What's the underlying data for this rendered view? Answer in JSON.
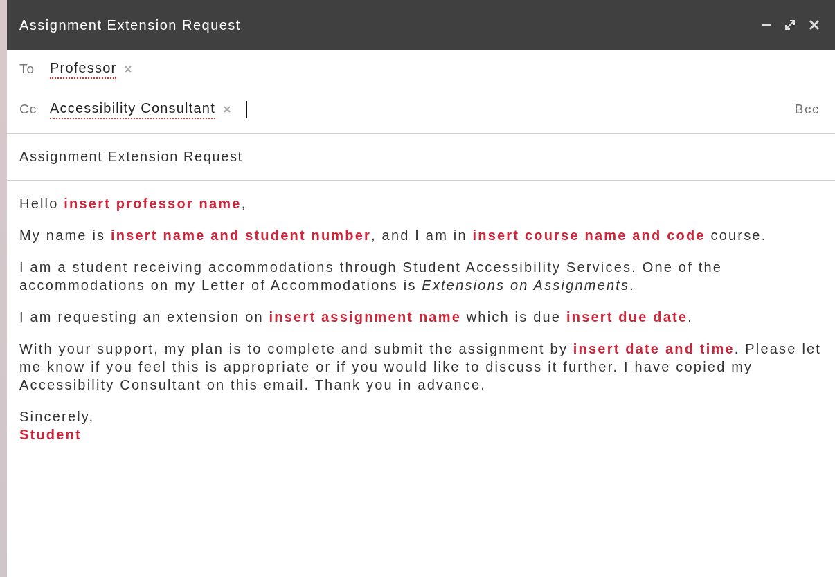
{
  "window": {
    "title": "Assignment Extension Request"
  },
  "recipients": [
    {
      "label": "To",
      "chips": [
        {
          "name": "Professor",
          "spell_flag": true
        }
      ],
      "cursor": false
    },
    {
      "label": "Cc",
      "chips": [
        {
          "name": "Accessibility Consultant",
          "spell_flag": true
        }
      ],
      "cursor": true,
      "bcc": "Bcc"
    }
  ],
  "subject": "Assignment Extension Request",
  "body": {
    "paragraphs": [
      "Hello **insert professor name**,",
      "My name is **insert name and student number**, and I am in **insert course name and code** course.",
      "I am a student receiving accommodations through Student Accessibility Services. One of the accommodations on my Letter of Accommodations is *Extensions on Assignments*.",
      "I am requesting an extension on **insert assignment name** which is due **insert due date**.",
      "With your support, my plan is to complete and submit the assignment by **insert date and time**. Please let me know if you feel this is appropriate or if you would like to discuss it further. I have copied my Accessibility Consultant on this email. Thank you in advance."
    ],
    "closing": "Sincerely,",
    "signature": "Student"
  }
}
